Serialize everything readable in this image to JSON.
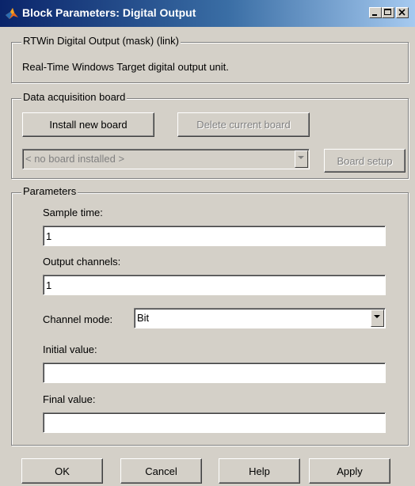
{
  "window": {
    "title": "Block Parameters: Digital Output",
    "controls": [
      "minimize",
      "maximize",
      "close"
    ],
    "colors": {
      "titlebar_start": "#0a246a",
      "titlebar_end": "#a6caf0",
      "face": "#d4d0c8"
    }
  },
  "mask": {
    "group_title": "RTWin Digital Output (mask) (link)",
    "description": "Real-Time Windows Target digital output unit."
  },
  "board": {
    "group_title": "Data acquisition board",
    "install_label": "Install new board",
    "delete_label": "Delete current board",
    "board_select_value": "< no board installed >",
    "setup_label": "Board setup"
  },
  "params": {
    "group_title": "Parameters",
    "sample_time_label": "Sample time:",
    "sample_time_value": "1",
    "output_channels_label": "Output channels:",
    "output_channels_value": "1",
    "channel_mode_label": "Channel mode:",
    "channel_mode_value": "Bit",
    "initial_value_label": "Initial value:",
    "initial_value_value": "",
    "final_value_label": "Final value:",
    "final_value_value": ""
  },
  "footer": {
    "ok_label": "OK",
    "cancel_label": "Cancel",
    "help_label": "Help",
    "apply_label": "Apply"
  }
}
